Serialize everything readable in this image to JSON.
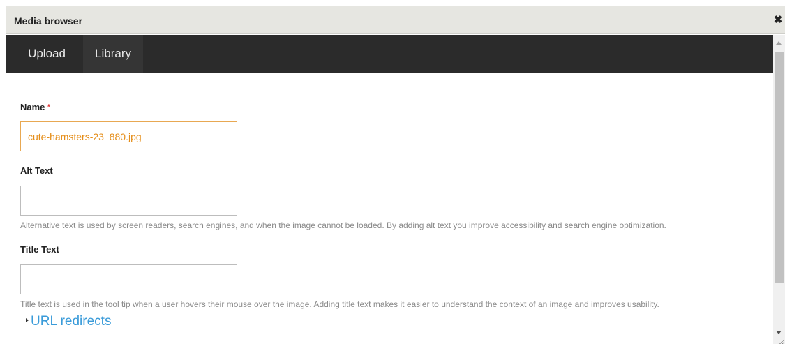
{
  "dialog": {
    "title": "Media browser",
    "close_symbol": "✖"
  },
  "tabs": [
    {
      "label": "Upload",
      "active": false
    },
    {
      "label": "Library",
      "active": true
    }
  ],
  "form": {
    "name": {
      "label": "Name",
      "required_marker": "*",
      "value": "cute-hamsters-23_880.jpg"
    },
    "alt_text": {
      "label": "Alt Text",
      "value": "",
      "description": "Alternative text is used by screen readers, search engines, and when the image cannot be loaded. By adding alt text you improve accessibility and search engine optimization."
    },
    "title_text": {
      "label": "Title Text",
      "value": "",
      "description": "Title text is used in the tool tip when a user hovers their mouse over the image. Adding title text makes it easier to understand the context of an image and improves usability."
    },
    "url_redirects": {
      "label": "URL redirects"
    }
  },
  "colors": {
    "tab_bar": "#2b2b2b",
    "focus_border": "#e8a852",
    "focus_text": "#e58d18",
    "link": "#3a9bd9",
    "required": "#e02020"
  }
}
